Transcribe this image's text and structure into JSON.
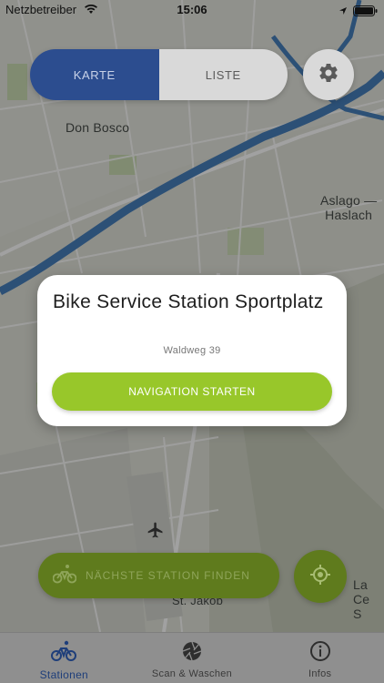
{
  "status_bar": {
    "carrier": "Netzbetreiber",
    "time": "15:06"
  },
  "segment": {
    "map_label": "KARTE",
    "list_label": "LISTE"
  },
  "map_labels": {
    "don_bosco": "Don Bosco",
    "aslago_line1": "Aslago —",
    "aslago_line2": "Haslach",
    "st_jakob": "St. Jakob",
    "la_ce_line1": "La Ce",
    "la_ce_line2": "S"
  },
  "popup": {
    "title": "Bike Service Station Sportplatz",
    "address": "Waldweg 39",
    "nav_label": "NAVIGATION STARTEN"
  },
  "find_button": {
    "label": "NÄCHSTE STATION FINDEN"
  },
  "tabs": [
    {
      "label": "Stationen",
      "icon": "bicycle-icon",
      "active": true
    },
    {
      "label": "Scan & Waschen",
      "icon": "camera-shutter-icon",
      "active": false
    },
    {
      "label": "Infos",
      "icon": "info-icon",
      "active": false
    }
  ],
  "colors": {
    "primary_blue": "#2c4d8f",
    "accent_green": "#98c72a",
    "dimmed_green": "#5f7b1d",
    "river": "#3d78b8"
  }
}
